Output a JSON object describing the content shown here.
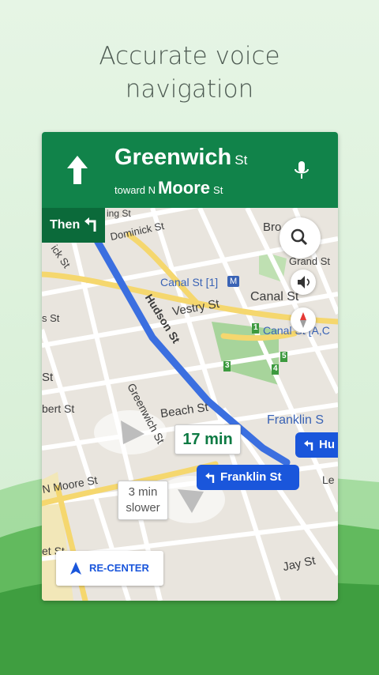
{
  "headline": {
    "line1": "Accurate voice",
    "line2": "navigation"
  },
  "navigation": {
    "main_street_name": "Greenwich",
    "main_street_suffix": "St",
    "toward_prefix": "toward N",
    "toward_street_name": "Moore",
    "toward_street_suffix": "St",
    "next_step_label": "Then",
    "direction_icon": "straight-arrow-icon",
    "next_step_icon": "turn-left-icon",
    "voice_icon": "microphone-icon"
  },
  "map": {
    "street_labels": {
      "ing_st": "ing St",
      "dominick_st": "Dominick St",
      "ick_st": "ick St",
      "bro": "Bro",
      "grand_st": "Grand St",
      "canal_st_station": "Canal St [1]",
      "subway_badge": "M",
      "canal_st": "Canal St",
      "canal_st_ac": "Canal St [A,C",
      "s_st": "s St",
      "vestry_st": "Vestry St",
      "hudson_st": "Hudson St",
      "st_left": "St",
      "bert_st": "bert St",
      "greenwich_st": "Greenwich St",
      "beach_st": "Beach St",
      "franklin_st_map": "Franklin S",
      "n_moore_st": "N Moore St",
      "le": "Le",
      "et_st": "et St",
      "jay_st": "Jay St"
    },
    "exit_markers": [
      "1",
      "3",
      "4",
      "5"
    ],
    "eta_text": "17 min",
    "slower_line1": "3 min",
    "slower_line2": "slower",
    "route_chip_primary": "Franklin St",
    "route_chip_secondary": "Hu"
  },
  "controls": {
    "search_icon": "search-icon",
    "sound_icon": "speaker-icon",
    "compass_icon": "compass-icon",
    "recenter_label": "RE-CENTER",
    "recenter_icon": "navigation-arrow-icon"
  },
  "colors": {
    "header_green": "#11834a",
    "then_green": "#0b6a3a",
    "route_blue": "#3b6fe0",
    "chip_blue": "#1a56db",
    "background_mint": "#e0f3df"
  }
}
